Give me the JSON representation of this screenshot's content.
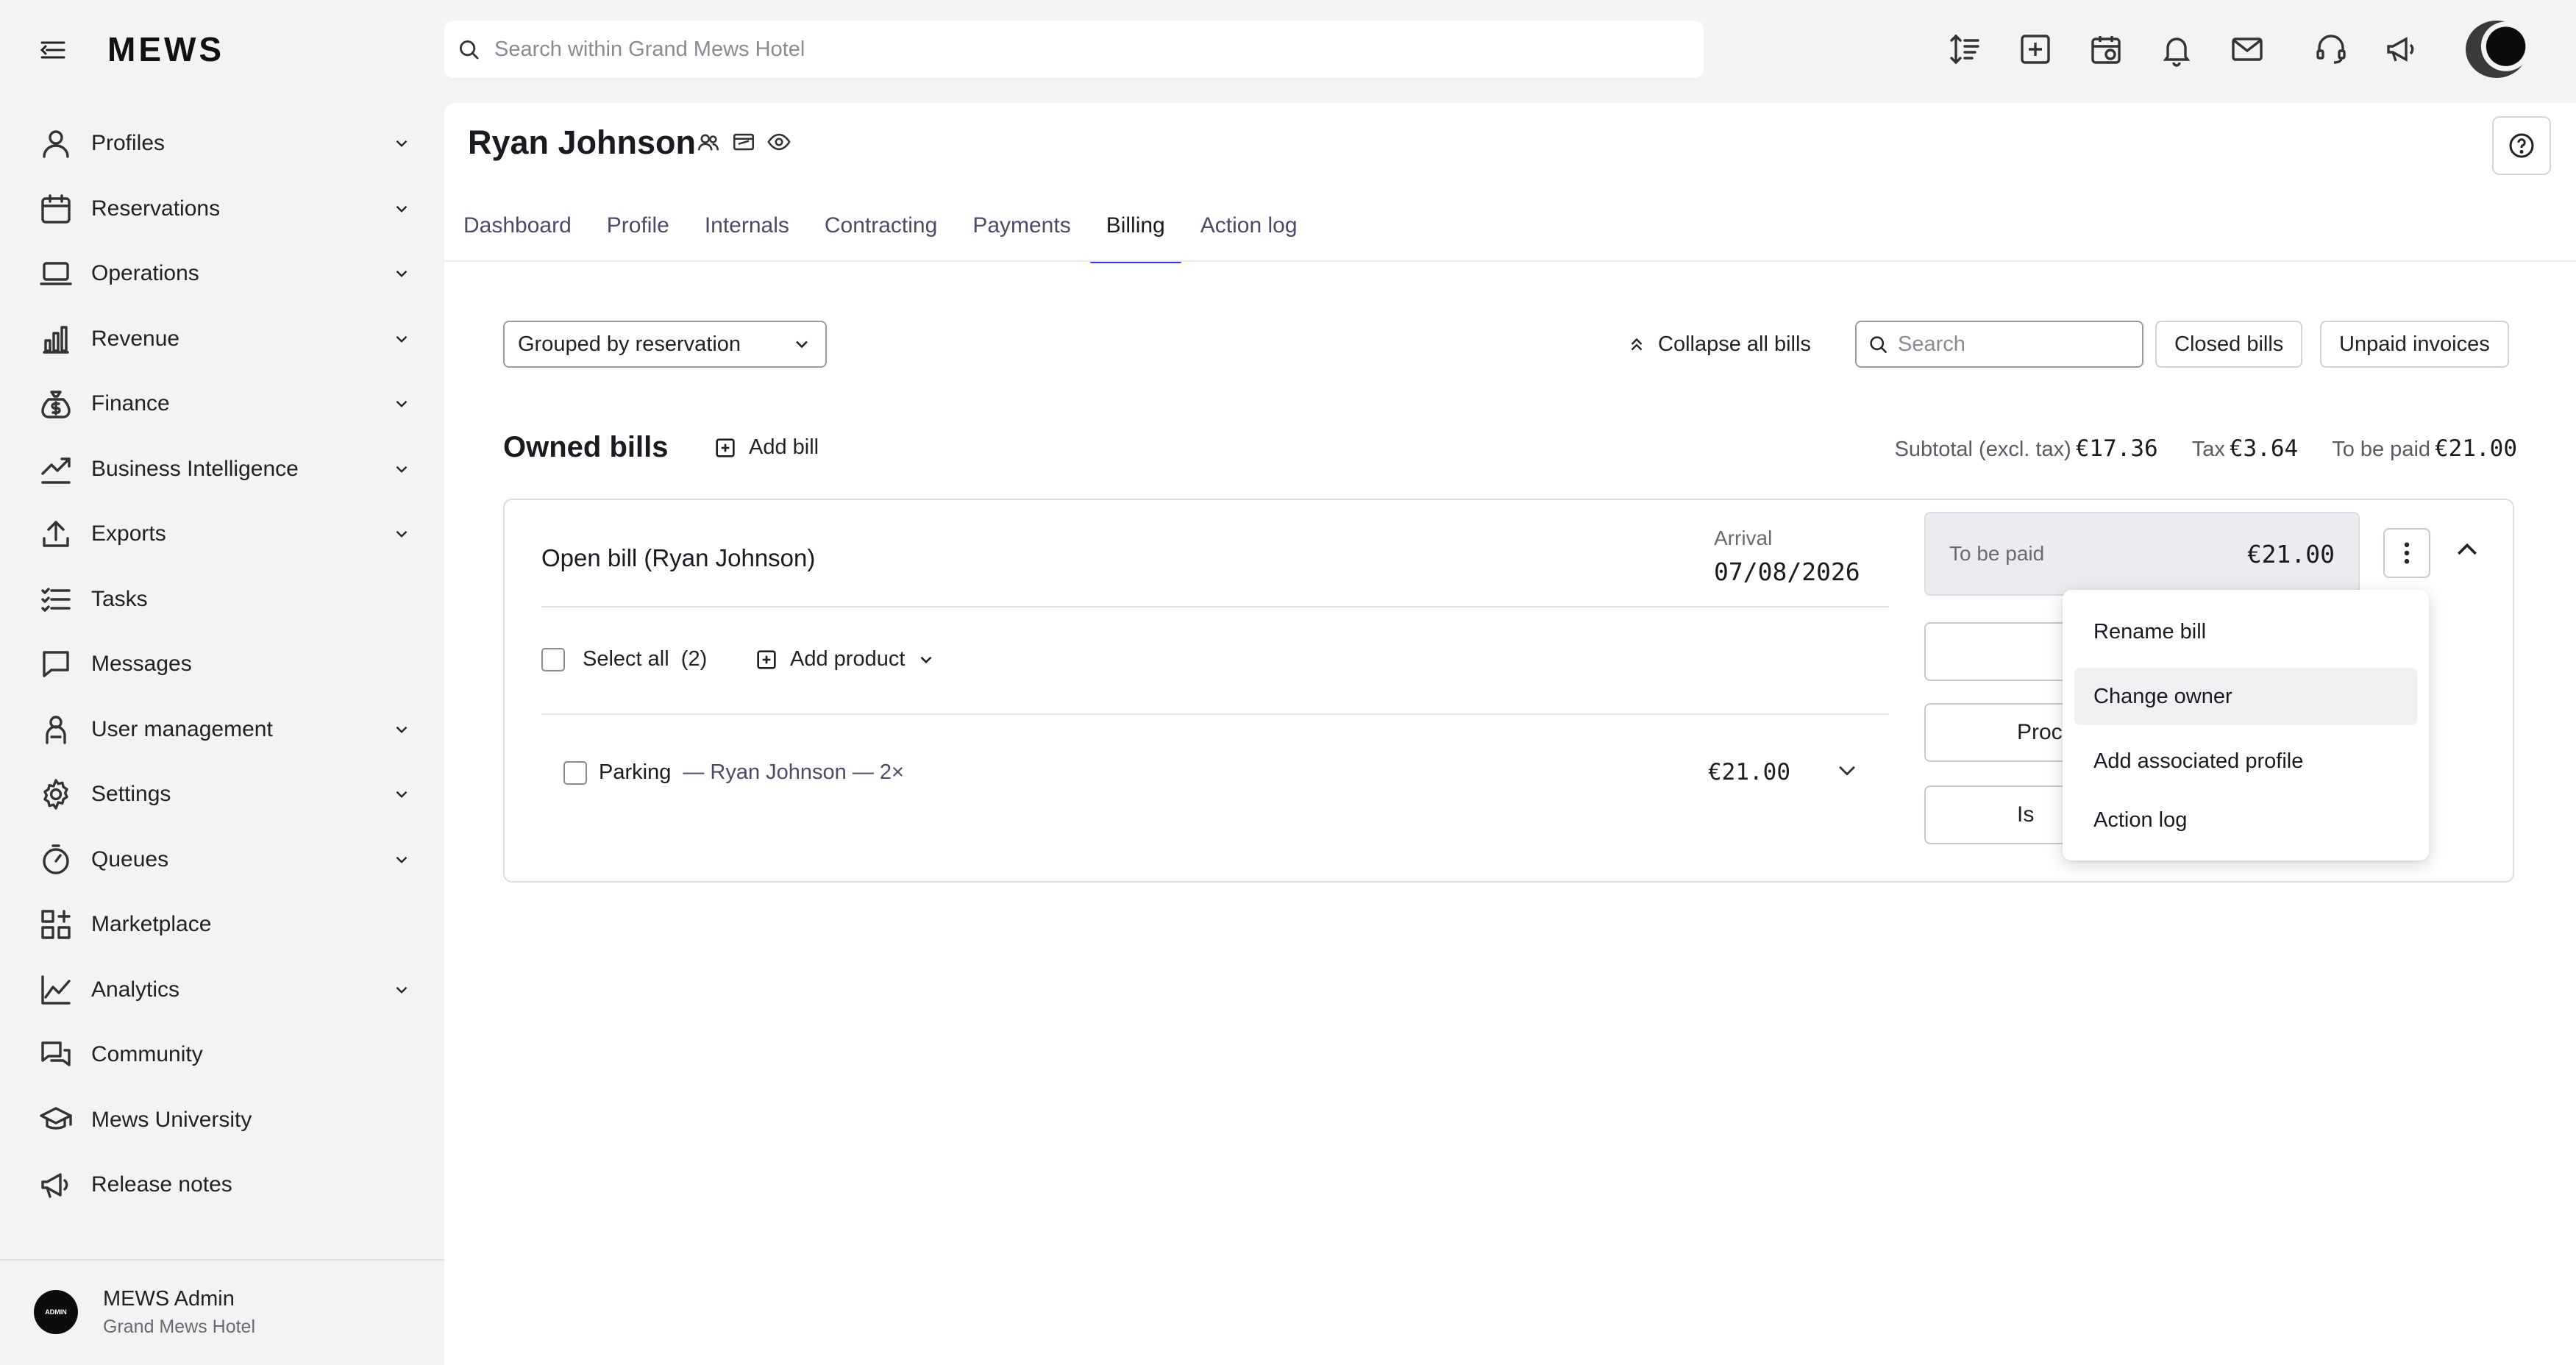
{
  "app": {
    "brand": "MEWS"
  },
  "search": {
    "placeholder": "Search within Grand Mews Hotel"
  },
  "topbar_icons": [
    "sort-icon",
    "add-icon",
    "calendar-icon",
    "bell-icon",
    "mail-icon",
    "support-icon",
    "megaphone-icon"
  ],
  "sidebar": {
    "items": [
      {
        "label": "Profiles",
        "icon": "person-icon",
        "expandable": true
      },
      {
        "label": "Reservations",
        "icon": "calendar-icon",
        "expandable": true
      },
      {
        "label": "Operations",
        "icon": "laptop-icon",
        "expandable": true
      },
      {
        "label": "Revenue",
        "icon": "bar-chart-icon",
        "expandable": true
      },
      {
        "label": "Finance",
        "icon": "money-bag-icon",
        "expandable": true
      },
      {
        "label": "Business Intelligence",
        "icon": "trend-icon",
        "expandable": true
      },
      {
        "label": "Exports",
        "icon": "upload-icon",
        "expandable": true
      },
      {
        "label": "Tasks",
        "icon": "tasks-icon",
        "expandable": false
      },
      {
        "label": "Messages",
        "icon": "chat-icon",
        "expandable": false
      },
      {
        "label": "User management",
        "icon": "users-icon",
        "expandable": true
      },
      {
        "label": "Settings",
        "icon": "gear-icon",
        "expandable": true
      },
      {
        "label": "Queues",
        "icon": "stopwatch-icon",
        "expandable": true
      },
      {
        "label": "Marketplace",
        "icon": "grid-plus-icon",
        "expandable": false
      },
      {
        "label": "Analytics",
        "icon": "line-chart-icon",
        "expandable": true
      },
      {
        "label": "Community",
        "icon": "community-icon",
        "expandable": false
      },
      {
        "label": "Mews University",
        "icon": "graduation-cap-icon",
        "expandable": false
      },
      {
        "label": "Release notes",
        "icon": "megaphone-icon",
        "expandable": false
      }
    ],
    "user": {
      "name": "MEWS Admin",
      "hotel": "Grand Mews Hotel",
      "avatar_text": "ADMIN"
    }
  },
  "profile": {
    "name": "Ryan Johnson",
    "tabs": [
      "Dashboard",
      "Profile",
      "Internals",
      "Contracting",
      "Payments",
      "Billing",
      "Action log"
    ],
    "active_tab": "Billing"
  },
  "billing": {
    "group_select": "Grouped by reservation",
    "collapse_all": "Collapse all bills",
    "search_placeholder": "Search",
    "closed_bills": "Closed bills",
    "unpaid_invoices": "Unpaid invoices",
    "owned_title": "Owned bills",
    "add_bill": "Add bill",
    "totals": {
      "subtotal_label": "Subtotal (excl. tax)",
      "subtotal_value": "€17.36",
      "tax_label": "Tax",
      "tax_value": "€3.64",
      "to_be_paid_label": "To be paid",
      "to_be_paid_value": "€21.00"
    },
    "bill": {
      "name": "Open bill (Ryan Johnson)",
      "arrival_label": "Arrival",
      "arrival_date": "07/08/2026",
      "to_be_paid_label": "To be paid",
      "to_be_paid_value": "€21.00",
      "select_all": "Select all",
      "select_count": "(2)",
      "add_product": "Add product",
      "items": [
        {
          "name": "Parking",
          "meta": "— Ryan Johnson — 2×",
          "price": "€21.00"
        }
      ],
      "side_buttons": [
        "",
        "Proc",
        "Is"
      ]
    },
    "menu": [
      "Rename bill",
      "Change owner",
      "Add associated profile",
      "Action log"
    ],
    "menu_hover": "Change owner"
  }
}
